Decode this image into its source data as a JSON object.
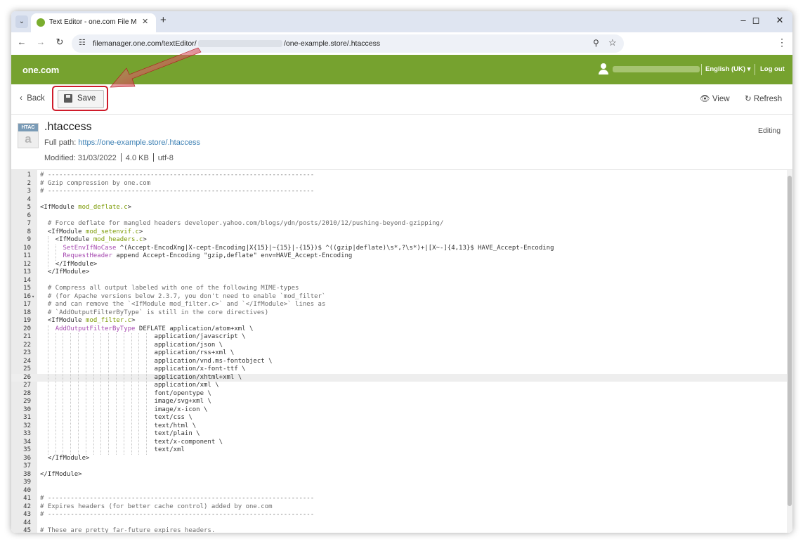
{
  "browser": {
    "tab_title": "Text Editor - one.com File Manager",
    "url_prefix": "filemanager.one.com/textEditor/",
    "url_suffix": "/one-example.store/.htaccess"
  },
  "header": {
    "logo": "one.com",
    "language": "English (UK)",
    "logout": "Log out"
  },
  "actions": {
    "back": "Back",
    "save": "Save",
    "view": "View",
    "refresh": "Refresh"
  },
  "file": {
    "icon_tag": "HTAC",
    "icon_glyph": "a",
    "name": ".htaccess",
    "full_path_label": "Full path:",
    "full_path_url": "https://one-example.store/.htaccess",
    "modified_label": "Modified:",
    "modified": "31/03/2022",
    "size": "4.0 KB",
    "encoding": "utf-8",
    "mode": "Editing"
  },
  "editor": {
    "active_line": 26,
    "lines": [
      [
        [
          "comment",
          "# ----------------------------------------------------------------------"
        ]
      ],
      [
        [
          "comment",
          "# Gzip compression by one.com"
        ]
      ],
      [
        [
          "comment",
          "# ----------------------------------------------------------------------"
        ]
      ],
      [],
      [
        [
          "plain",
          "<IfModule "
        ],
        [
          "kw",
          "mod_deflate.c"
        ],
        [
          "plain",
          ">"
        ]
      ],
      [],
      [
        [
          "plain",
          "  "
        ],
        [
          "comment",
          "# Force deflate for mangled headers developer.yahoo.com/blogs/ydn/posts/2010/12/pushing-beyond-gzipping/"
        ]
      ],
      [
        [
          "plain",
          "  <IfModule "
        ],
        [
          "kw",
          "mod_setenvif.c"
        ],
        [
          "plain",
          ">"
        ]
      ],
      [
        [
          "plain",
          "    <IfModule "
        ],
        [
          "kw",
          "mod_headers.c"
        ],
        [
          "plain",
          ">"
        ]
      ],
      [
        [
          "plain",
          "      "
        ],
        [
          "fn",
          "SetEnvIfNoCase"
        ],
        [
          "plain",
          " ^(Accept-EncodXng|X-cept-Encoding|X{15}|~{15}|-{15})$ ^((gzip|deflate)\\s*,?\\s*)+|[X~-]{4,13}$ HAVE_Accept-Encoding"
        ]
      ],
      [
        [
          "plain",
          "      "
        ],
        [
          "fn",
          "RequestHeader"
        ],
        [
          "plain",
          " append Accept-Encoding \"gzip,deflate\" env=HAVE_Accept-Encoding"
        ]
      ],
      [
        [
          "plain",
          "    </IfModule>"
        ]
      ],
      [
        [
          "plain",
          "  </IfModule>"
        ]
      ],
      [],
      [
        [
          "plain",
          "  "
        ],
        [
          "comment",
          "# Compress all output labeled with one of the following MIME-types"
        ]
      ],
      [
        [
          "plain",
          "  "
        ],
        [
          "comment",
          "# (for Apache versions below 2.3.7, you don't need to enable `mod_filter`"
        ]
      ],
      [
        [
          "plain",
          "  "
        ],
        [
          "comment",
          "# and can remove the `<IfModule mod_filter.c>` and `</IfModule>` lines as"
        ]
      ],
      [
        [
          "plain",
          "  "
        ],
        [
          "comment",
          "# `AddOutputFilterByType` is still in the core directives)"
        ]
      ],
      [
        [
          "plain",
          "  <IfModule "
        ],
        [
          "kw",
          "mod_filter.c"
        ],
        [
          "plain",
          ">"
        ]
      ],
      [
        [
          "plain",
          "    "
        ],
        [
          "fn",
          "AddOutputFilterByType"
        ],
        [
          "plain",
          " DEFLATE application/atom+xml \\"
        ]
      ],
      [
        [
          "plain",
          "                              application/javascript \\"
        ]
      ],
      [
        [
          "plain",
          "                              application/json \\"
        ]
      ],
      [
        [
          "plain",
          "                              application/rss+xml \\"
        ]
      ],
      [
        [
          "plain",
          "                              application/vnd.ms-fontobject \\"
        ]
      ],
      [
        [
          "plain",
          "                              application/x-font-ttf \\"
        ]
      ],
      [
        [
          "plain",
          "                              application/xhtml+xml \\"
        ]
      ],
      [
        [
          "plain",
          "                              application/xml \\"
        ]
      ],
      [
        [
          "plain",
          "                              font/opentype \\"
        ]
      ],
      [
        [
          "plain",
          "                              image/svg+xml \\"
        ]
      ],
      [
        [
          "plain",
          "                              image/x-icon \\"
        ]
      ],
      [
        [
          "plain",
          "                              text/css \\"
        ]
      ],
      [
        [
          "plain",
          "                              text/html \\"
        ]
      ],
      [
        [
          "plain",
          "                              text/plain \\"
        ]
      ],
      [
        [
          "plain",
          "                              text/x-component \\"
        ]
      ],
      [
        [
          "plain",
          "                              text/xml"
        ]
      ],
      [
        [
          "plain",
          "  </IfModule>"
        ]
      ],
      [],
      [
        [
          "plain",
          "</IfModule>"
        ]
      ],
      [],
      [],
      [
        [
          "comment",
          "# ----------------------------------------------------------------------"
        ]
      ],
      [
        [
          "comment",
          "# Expires headers (for better cache control) added by one.com"
        ]
      ],
      [
        [
          "comment",
          "# ----------------------------------------------------------------------"
        ]
      ],
      [],
      [
        [
          "comment",
          "# These are pretty far-future expires headers."
        ]
      ]
    ]
  }
}
